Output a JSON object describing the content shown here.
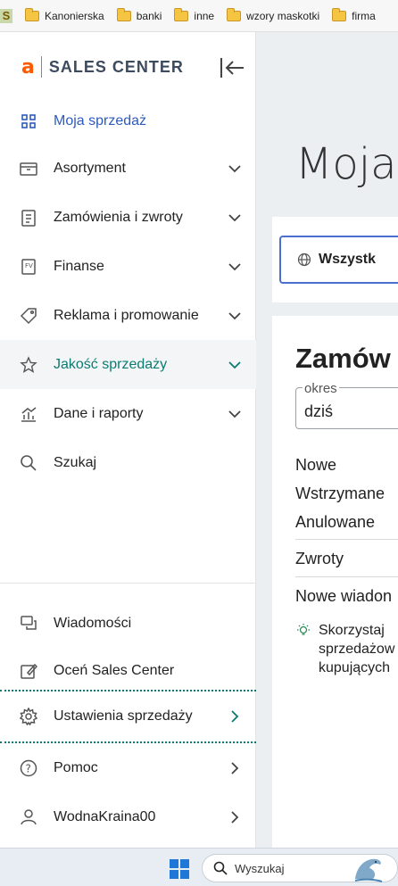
{
  "bookmarks": {
    "first_icon_letter": "S",
    "items": [
      "Kanonierska",
      "banki",
      "inne",
      "wzory maskotki",
      "firma"
    ]
  },
  "sidebar": {
    "logo_letter": "a",
    "logo_text": "SALES CENTER",
    "items": [
      {
        "label": "Moja sprzedaż",
        "icon": "grid-icon"
      },
      {
        "label": "Asortyment",
        "icon": "inventory-icon"
      },
      {
        "label": "Zamówienia i zwroty",
        "icon": "orders-icon"
      },
      {
        "label": "Finanse",
        "icon": "invoice-icon"
      },
      {
        "label": "Reklama i promowanie",
        "icon": "tag-icon"
      },
      {
        "label": "Jakość sprzedaży",
        "icon": "star-icon"
      },
      {
        "label": "Dane i raporty",
        "icon": "chart-icon"
      },
      {
        "label": "Szukaj",
        "icon": "search-icon"
      }
    ],
    "bottom_items": [
      {
        "label": "Wiadomości",
        "icon": "chat-icon"
      },
      {
        "label": "Oceń Sales Center",
        "icon": "edit-icon"
      },
      {
        "label": "Ustawienia sprzedaży",
        "icon": "gear-icon"
      },
      {
        "label": "Pomoc",
        "icon": "help-icon"
      },
      {
        "label": "WodnaKraina00",
        "icon": "user-icon"
      }
    ]
  },
  "main": {
    "page_title": "Moja",
    "tab_all": "Wszystk",
    "orders_title": "Zamów",
    "period_label": "okres",
    "period_value": "dziś",
    "rows": [
      "Nowe",
      "Wstrzymane",
      "Anulowane",
      "Zwroty",
      "Nowe wiadon"
    ],
    "tip": "Skorzystaj\nsprzedażow\nkupujących"
  },
  "taskbar": {
    "search_placeholder": "Wyszukaj"
  },
  "colors": {
    "brand_orange": "#ff5a00",
    "active_blue": "#2c5bbd",
    "quality_teal": "#0c7b71"
  }
}
